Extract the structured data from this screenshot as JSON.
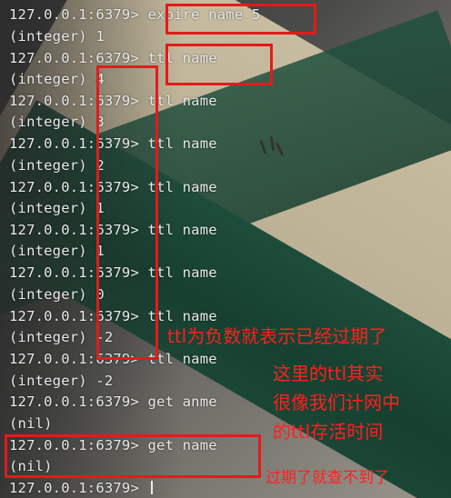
{
  "terminal": {
    "lines": [
      "127.0.0.1:6379> expire name 5",
      "(integer) 1",
      "127.0.0.1:6379> ttl name",
      "(integer) 4",
      "127.0.0.1:6379> ttl name",
      "(integer) 3",
      "127.0.0.1:6379> ttl name",
      "(integer) 2",
      "127.0.0.1:6379> ttl name",
      "(integer) 1",
      "127.0.0.1:6379> ttl name",
      "(integer) 1",
      "127.0.0.1:6379> ttl name",
      "(integer) 0",
      "127.0.0.1:6379> ttl name",
      "(integer) -2",
      "127.0.0.1:6379> ttl name",
      "(integer) -2",
      "127.0.0.1:6379> get anme",
      "(nil)",
      "127.0.0.1:6379> get name",
      "(nil)",
      "127.0.0.1:6379> "
    ]
  },
  "annotations": {
    "note_negative": "ttl为负数就表示已经过期了",
    "note_network_1": "这里的ttl其实",
    "note_network_2": "很像我们计网中",
    "note_network_3": "的ttl存活时间",
    "note_expired": "过期了就查不到了"
  },
  "colors": {
    "annotation_red": "#e21b1b",
    "terminal_text": "#e9e9e9"
  }
}
